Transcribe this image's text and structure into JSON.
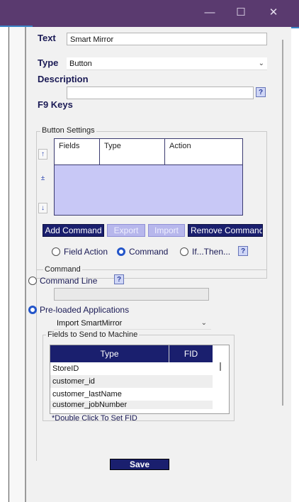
{
  "window": {
    "minimize_glyph": "—",
    "maximize_glyph": "☐",
    "close_glyph": "✕"
  },
  "form": {
    "text_label": "Text",
    "text_value": "Smart Mirror",
    "type_label": "Type",
    "type_value": "Button",
    "description_label": "Description",
    "description_value": "",
    "f9_label": "F9 Keys",
    "help_mark": "?"
  },
  "button_settings": {
    "legend": "Button Settings",
    "side_buttons": [
      "↑",
      "±",
      "↓"
    ],
    "grid_columns": [
      "Fields",
      "Type",
      "Action"
    ],
    "actions": {
      "add": "Add Command",
      "export": "Export",
      "import": "Import",
      "remove": "Remove Command"
    },
    "radios": {
      "field_action": "Field Action",
      "command": "Command",
      "if_then": "If...Then..."
    }
  },
  "command": {
    "legend": "Command",
    "command_line_label": "Command Line",
    "preloaded_label": "Pre-loaded Applications",
    "preloaded_value": "Import SmartMirror",
    "fields_legend": "Fields to Send to Machine",
    "columns": [
      "Type",
      "FID"
    ],
    "rows": [
      "StoreID",
      "customer_id",
      "customer_lastName",
      "customer_jobNumber"
    ],
    "hint": "*Double Click To Set FID"
  },
  "footer": {
    "save_label": "Save"
  },
  "colors": {
    "titlebar": "#5a3a6f",
    "navy": "#1a1f6e",
    "grid_fill": "#c8c8f6",
    "radio_on": "#2355c9"
  }
}
